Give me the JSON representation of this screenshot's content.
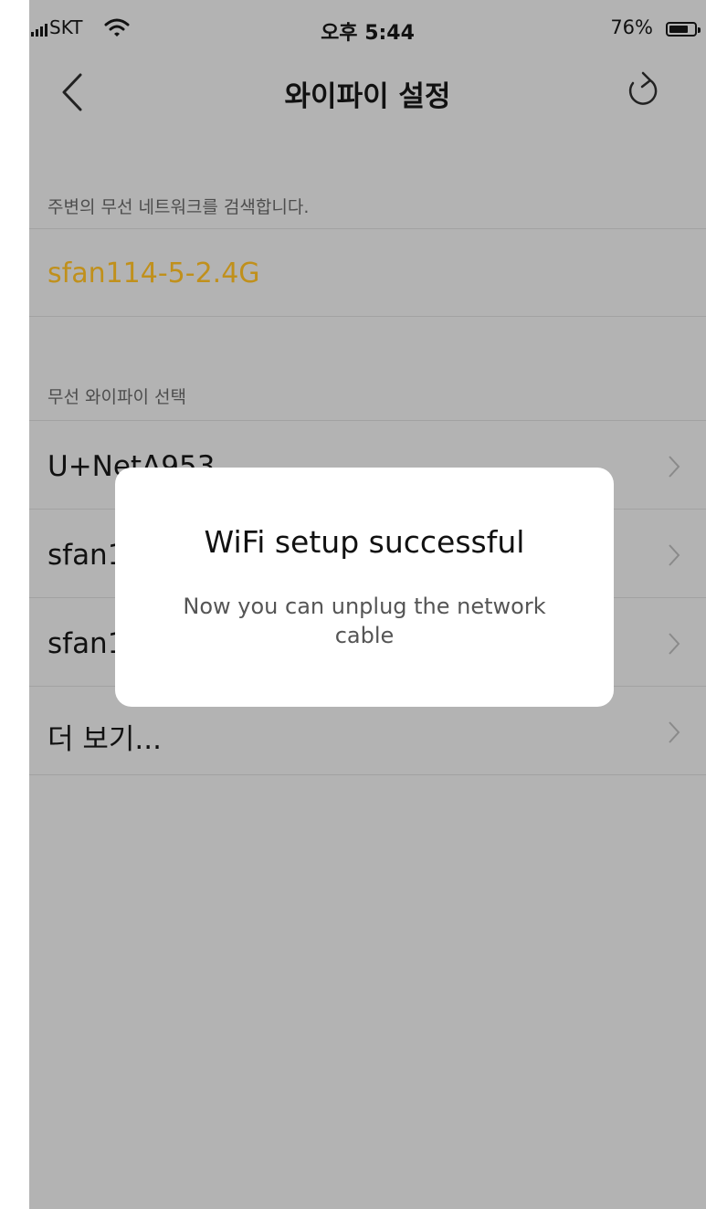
{
  "status_bar": {
    "carrier": "SKT",
    "time": "오후 5:44",
    "battery_percent": "76%",
    "battery_level": 0.76,
    "icons": [
      "signal-icon",
      "wifi-icon",
      "battery-icon"
    ]
  },
  "nav": {
    "title": "와이파이 설정",
    "back_icon": "chevron-left-icon",
    "refresh_icon": "refresh-icon"
  },
  "nearby_section": {
    "header": "주변의 무선 네트워크를 검색합니다.",
    "current_network": "sfan114-5-2.4G"
  },
  "select_section": {
    "header": "무선 와이파이 선택",
    "items": [
      {
        "label": "U+NetA953"
      },
      {
        "label": "sfan1"
      },
      {
        "label": "sfan1"
      },
      {
        "label": "더 보기..."
      }
    ]
  },
  "dialog": {
    "title": "WiFi setup successful",
    "message": "Now you can unplug the network cable"
  },
  "colors": {
    "background": "#b3b3b3",
    "current_network": "#c0901c",
    "dialog_bg": "#ffffff"
  }
}
